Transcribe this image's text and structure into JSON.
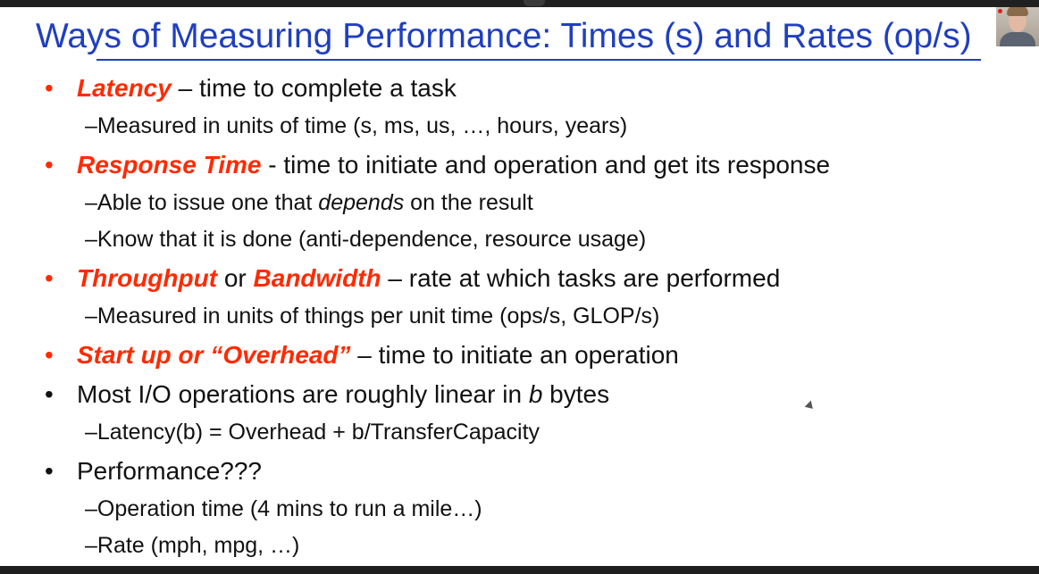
{
  "title": "Ways of Measuring Performance: Times (s) and Rates (op/s)",
  "bullets": [
    {
      "bullet": "•",
      "term": "Latency",
      "text": " – time to complete a task"
    },
    {
      "dash": "– ",
      "text": "Measured in units of time (s, ms, us, …, hours, years)"
    },
    {
      "bullet": "•",
      "term": "Response Time",
      "text": " - time to initiate and operation and get its response"
    },
    {
      "dash": "– ",
      "pre": "Able to issue one that ",
      "emph": "depends",
      "post": " on the result"
    },
    {
      "dash": "– ",
      "text": "Know that it is done (anti-dependence, resource usage)"
    },
    {
      "bullet": "•",
      "term": "Throughput",
      "mid": " or ",
      "term2": "Bandwidth",
      "text": " – rate at which tasks are performed"
    },
    {
      "dash": "– ",
      "text": "Measured in units of things per unit time (ops/s, GLOP/s)"
    },
    {
      "bullet": "•",
      "term": "Start up or “Overhead”",
      "text": " – time to initiate an operation"
    },
    {
      "bullet": "•",
      "pre": "Most I/O operations are roughly linear in ",
      "emph": "b",
      "post": " bytes"
    },
    {
      "dash": "– ",
      "text": "Latency(b) = Overhead + b/TransferCapacity"
    },
    {
      "bullet": "•",
      "text": "Performance???"
    },
    {
      "dash": "– ",
      "text": "Operation time (4 mins to run a mile…)"
    },
    {
      "dash": "– ",
      "text": "Rate (mph, mpg, …)"
    }
  ],
  "colors": {
    "title": "#1f3fbf",
    "accent": "#ff2a00"
  }
}
